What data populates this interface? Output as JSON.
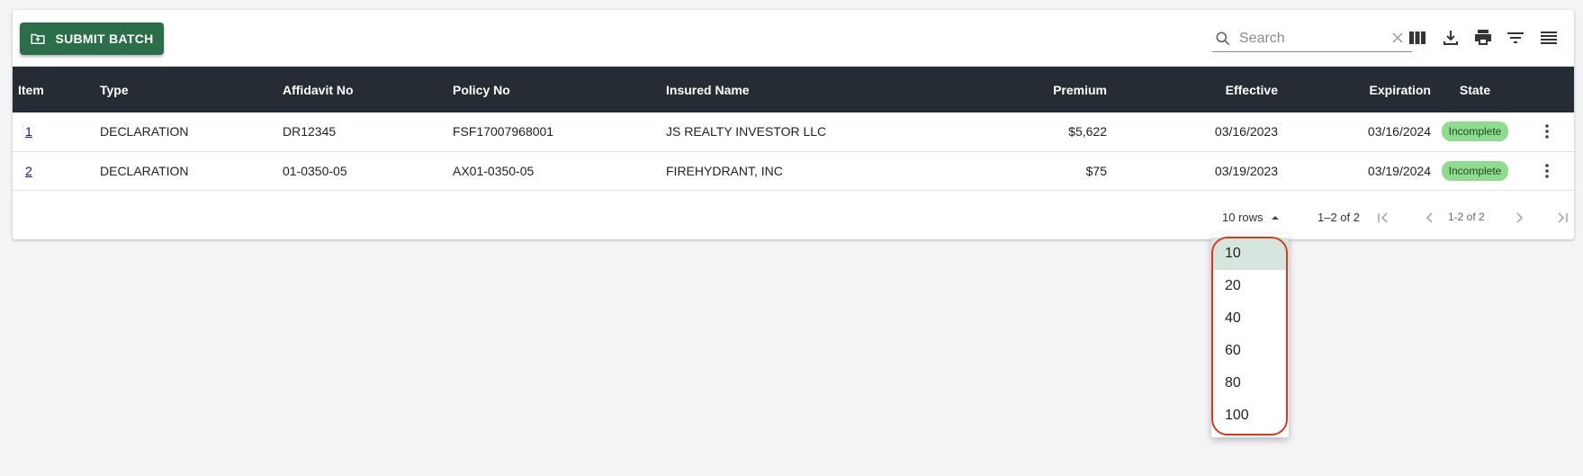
{
  "toolbar": {
    "submit_label": "SUBMIT BATCH",
    "search_placeholder": "Search",
    "icons": [
      "view-column-icon",
      "download-icon",
      "print-icon",
      "filter-icon",
      "menu-icon"
    ]
  },
  "table": {
    "headers": {
      "item": "Item",
      "type": "Type",
      "affidavit": "Affidavit No",
      "policy": "Policy No",
      "insured": "Insured Name",
      "premium": "Premium",
      "effective": "Effective",
      "expiration": "Expiration",
      "state": "State"
    },
    "rows": [
      {
        "item": "1",
        "type": "DECLARATION",
        "affidavit": "DR12345",
        "policy": "FSF17007968001",
        "insured": "JS REALTY INVESTOR LLC",
        "premium": "$5,622",
        "effective": "03/16/2023",
        "expiration": "03/16/2024",
        "state": "Incomplete"
      },
      {
        "item": "2",
        "type": "DECLARATION",
        "affidavit": "01-0350-05",
        "policy": "AX01-0350-05",
        "insured": "FIREHYDRANT, INC",
        "premium": "$75",
        "effective": "03/19/2023",
        "expiration": "03/19/2024",
        "state": "Incomplete"
      }
    ]
  },
  "pagination": {
    "rows_label": "10 rows",
    "range": "1–2 of 2",
    "range_secondary": "1-2 of 2"
  },
  "dropdown": {
    "options": [
      "10",
      "20",
      "40",
      "60",
      "80",
      "100"
    ],
    "selected": "10"
  },
  "colors": {
    "primary": "#2a6e4a",
    "header_bg": "#252c33",
    "badge_bg": "#8fdb8f",
    "highlight_outline": "#d9391f",
    "selected_option_bg": "#d7e5df"
  }
}
